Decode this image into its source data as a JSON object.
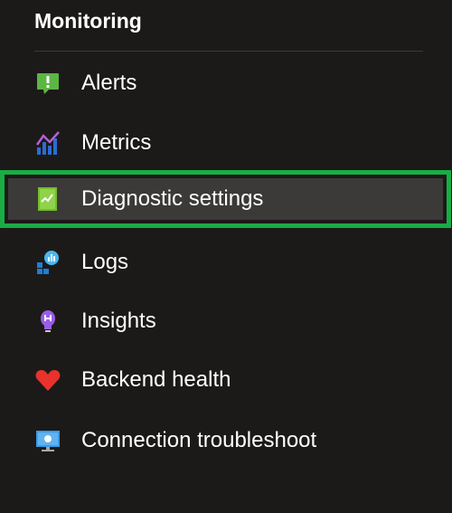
{
  "section": {
    "title": "Monitoring"
  },
  "items": [
    {
      "id": "alerts",
      "label": "Alerts",
      "icon": "alert-icon",
      "selected": false
    },
    {
      "id": "metrics",
      "label": "Metrics",
      "icon": "metrics-icon",
      "selected": false
    },
    {
      "id": "diagnostic-settings",
      "label": "Diagnostic settings",
      "icon": "diagnostic-settings-icon",
      "selected": true
    },
    {
      "id": "logs",
      "label": "Logs",
      "icon": "logs-icon",
      "selected": false
    },
    {
      "id": "insights",
      "label": "Insights",
      "icon": "lightbulb-icon",
      "selected": false
    },
    {
      "id": "backend-health",
      "label": "Backend health",
      "icon": "heart-icon",
      "selected": false
    },
    {
      "id": "connection-troubleshoot",
      "label": "Connection troubleshoot",
      "icon": "monitor-icon",
      "selected": false
    }
  ],
  "colors": {
    "background": "#1b1a19",
    "selected_background": "#3b3a39",
    "highlight_border": "#1aac44",
    "text": "#ffffff"
  }
}
